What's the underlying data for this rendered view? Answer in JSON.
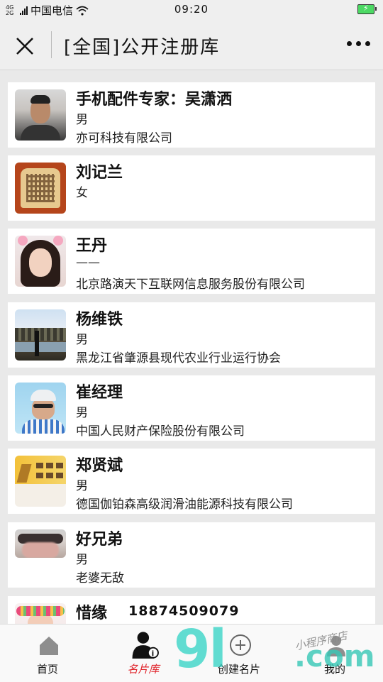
{
  "status_bar": {
    "network": "4G 2G",
    "carrier": "中国电信",
    "time": "09:20",
    "battery_color": "#4cd964"
  },
  "nav": {
    "title": "[全国]公开注册库",
    "close_icon": "close-icon",
    "more_icon": "more-dots-icon"
  },
  "cards": [
    {
      "name": "手机配件专家：吴潇洒",
      "line1": "男",
      "line2": "亦可科技有限公司"
    },
    {
      "name": "刘记兰",
      "line1": "女",
      "line2": ""
    },
    {
      "name": "王丹",
      "line1": "——",
      "line2": "北京路演天下互联网信息服务股份有限公司"
    },
    {
      "name": "杨维铁",
      "line1": "男",
      "line2": "黑龙江省肇源县现代农业行业运行协会"
    },
    {
      "name": "崔经理",
      "line1": "男",
      "line2": "中国人民财产保险股份有限公司"
    },
    {
      "name": "郑贤斌",
      "line1": "男",
      "line2": "德国伽铂森高级润滑油能源科技有限公司"
    },
    {
      "name": "好兄弟",
      "line1": "男",
      "line2": "老婆无敌"
    },
    {
      "name": "惜缘",
      "phone": "18874509079",
      "line1": "",
      "line2": ""
    }
  ],
  "tabs": [
    {
      "label": "首页",
      "icon": "home-icon"
    },
    {
      "label": "名片库",
      "icon": "business-person-icon"
    },
    {
      "label": "创建名片",
      "icon": "add-circle-icon"
    },
    {
      "label": "我的",
      "icon": "user-icon"
    }
  ],
  "watermark": {
    "big": "9l",
    "com": ".com",
    "small": "小程序商店"
  },
  "colors": {
    "active_tab": "#e0242b",
    "watermark": "#2fd3c4"
  }
}
